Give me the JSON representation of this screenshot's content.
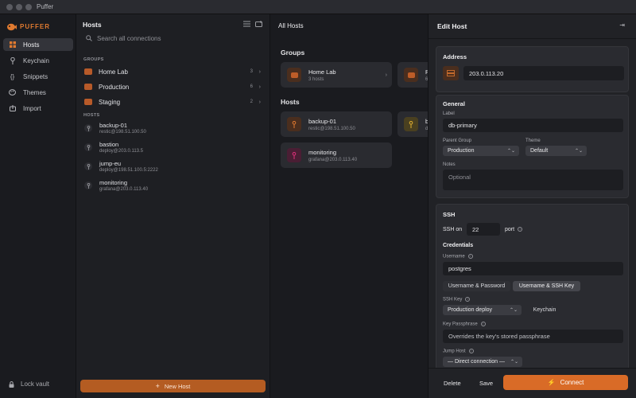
{
  "window": {
    "title": "Puffer"
  },
  "sidebar": {
    "logo": "PUFFER",
    "items": [
      {
        "label": "Hosts",
        "icon": "grid-icon",
        "active": true
      },
      {
        "label": "Keychain",
        "icon": "key-icon"
      },
      {
        "label": "Snippets",
        "icon": "braces-icon"
      },
      {
        "label": "Themes",
        "icon": "palette-icon"
      },
      {
        "label": "Import",
        "icon": "import-icon"
      }
    ],
    "lock_label": "Lock vault"
  },
  "hosts_panel": {
    "title": "Hosts",
    "search_placeholder": "Search all connections",
    "groups_label": "GROUPS",
    "groups": [
      {
        "name": "Home Lab",
        "count": "3"
      },
      {
        "name": "Production",
        "count": "6"
      },
      {
        "name": "Staging",
        "count": "2"
      }
    ],
    "hosts_label": "HOSTS",
    "hosts": [
      {
        "name": "backup-01",
        "sub": "restic@198.51.100.50"
      },
      {
        "name": "bastion",
        "sub": "deploy@203.0.113.5"
      },
      {
        "name": "jump-eu",
        "sub": "deploy@198.51.100.5:2222"
      },
      {
        "name": "monitoring",
        "sub": "grafana@203.0.113.40"
      }
    ],
    "new_host_label": "New Host"
  },
  "main": {
    "title": "All Hosts",
    "groups_heading": "Groups",
    "group_cards": [
      {
        "name": "Home Lab",
        "sub": "3 hosts"
      },
      {
        "name": "P",
        "sub": "6"
      }
    ],
    "hosts_heading": "Hosts",
    "host_cards": [
      {
        "name": "backup-01",
        "sub": "restic@198.51.100.50"
      },
      {
        "name": "ba",
        "sub": "de"
      },
      {
        "name": "monitoring",
        "sub": "grafana@203.0.113.40"
      }
    ]
  },
  "drawer": {
    "title": "Edit Host",
    "address_heading": "Address",
    "address_value": "203.0.113.20",
    "general_heading": "General",
    "label_label": "Label",
    "label_value": "db-primary",
    "parent_group_label": "Parent Group",
    "parent_group_value": "Production",
    "theme_label": "Theme",
    "theme_value": "Default",
    "notes_label": "Notes",
    "notes_placeholder": "Optional",
    "ssh_heading": "SSH",
    "ssh_on_label": "SSH on",
    "port_value": "22",
    "port_label": "port",
    "credentials_heading": "Credentials",
    "username_label": "Username",
    "username_value": "postgres",
    "auth_options": [
      "Username & Password",
      "Username & SSH Key"
    ],
    "auth_selected": "Username & SSH Key",
    "ssh_key_label": "SSH Key",
    "ssh_key_value": "Production deploy",
    "keychain_button": "Keychain",
    "passphrase_label": "Key Passphrase",
    "passphrase_placeholder": "Overrides the key's stored passphrase",
    "jump_host_label": "Jump Host",
    "jump_host_value": "— Direct connection —",
    "delete_label": "Delete",
    "save_label": "Save",
    "connect_label": "Connect"
  },
  "colors": {
    "accent": "#d96b27",
    "background": "#1c1d21"
  }
}
